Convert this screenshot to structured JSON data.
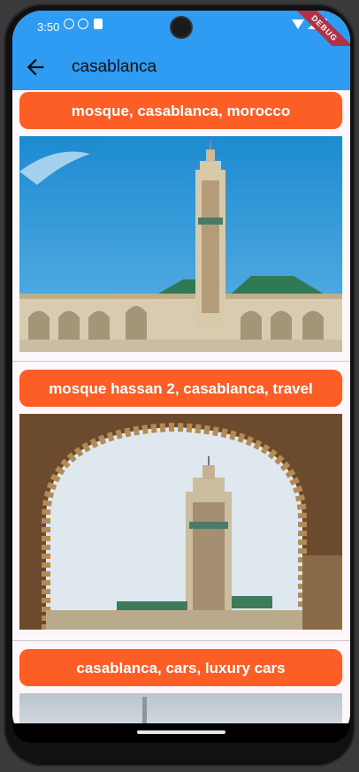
{
  "status_bar": {
    "time": "3:50"
  },
  "debug_banner": "DEBUG",
  "app_bar": {
    "title": "casablanca"
  },
  "results": [
    {
      "label": "mosque, casablanca, morocco"
    },
    {
      "label": "mosque hassan 2, casablanca, travel"
    },
    {
      "label": "casablanca, cars, luxury cars"
    }
  ],
  "colors": {
    "app_bar": "#2d9cf2",
    "tag_button": "#fc5e26",
    "content_background": "#fdf6fb"
  }
}
